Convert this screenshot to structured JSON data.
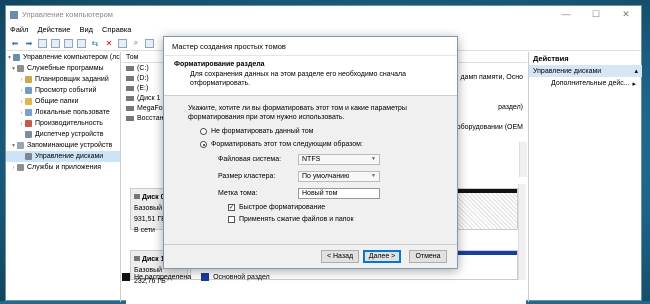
{
  "window": {
    "title": "Управление компьютером"
  },
  "menu": [
    "Файл",
    "Действие",
    "Вид",
    "Справка"
  ],
  "tree": [
    {
      "label": "Управление компьютером (лс",
      "depth": 0,
      "arrow": "▾"
    },
    {
      "label": "Служебные программы",
      "depth": 1,
      "arrow": "▾"
    },
    {
      "label": "Планировщик заданий",
      "depth": 2,
      "arrow": "›"
    },
    {
      "label": "Просмотр событий",
      "depth": 2,
      "arrow": "›"
    },
    {
      "label": "Общие папки",
      "depth": 2,
      "arrow": "›"
    },
    {
      "label": "Локальные пользовате",
      "depth": 2,
      "arrow": "›"
    },
    {
      "label": "Производительность",
      "depth": 2,
      "arrow": "›"
    },
    {
      "label": "Диспетчер устройств",
      "depth": 2,
      "arrow": ""
    },
    {
      "label": "Запоминающие устройств",
      "depth": 1,
      "arrow": "▾"
    },
    {
      "label": "Управление дисками",
      "depth": 2,
      "arrow": "",
      "selected": true
    },
    {
      "label": "Службы и приложения",
      "depth": 1,
      "arrow": "›"
    }
  ],
  "volumes": {
    "header": "Том",
    "rows": [
      "(C:)",
      "(D:)",
      "(E:)",
      "(Диск 1",
      "MegaFon",
      "Восстано"
    ],
    "right_fragments": [
      "дамп памяти, Осно",
      "раздел)",
      "оборудовании (OEM"
    ]
  },
  "disks": [
    {
      "name": "Диск 0",
      "type": "Базовый",
      "size": "931,51 ГБ",
      "status": "В сети"
    },
    {
      "name": "Диск 1",
      "type": "Базовый",
      "size": "232,76 ГБ"
    }
  ],
  "legend": {
    "unallocated": "Не распределена",
    "primary": "Основной раздел"
  },
  "actions": {
    "header": "Действия",
    "section": "Управление дисками",
    "more": "Дополнительные дейс..."
  },
  "wizard": {
    "title": "Мастер создания простых томов",
    "heading": "Форматирование раздела",
    "subheading": "Для сохранения данных на этом разделе его необходимо сначала отформатировать.",
    "prompt": "Укажите, хотите ли вы форматировать этот том и какие параметры форматирования при этом нужно использовать.",
    "radio_no": "Не форматировать данный том",
    "radio_yes": "Форматировать этот том следующим образом:",
    "fs_label": "Файловая система:",
    "fs_value": "NTFS",
    "cluster_label": "Размер кластера:",
    "cluster_value": "По умолчанию",
    "volume_label_label": "Метка тома:",
    "volume_label_value": "Новый том",
    "quick_format": "Быстрое форматирование",
    "compression": "Применять сжатие файлов и папок",
    "back": "< Назад",
    "next": "Далее >",
    "cancel": "Отмена"
  },
  "colors": {
    "primary_partition": "#1b3d9c",
    "unallocated": "#111111",
    "selection": "#cce4f7"
  }
}
